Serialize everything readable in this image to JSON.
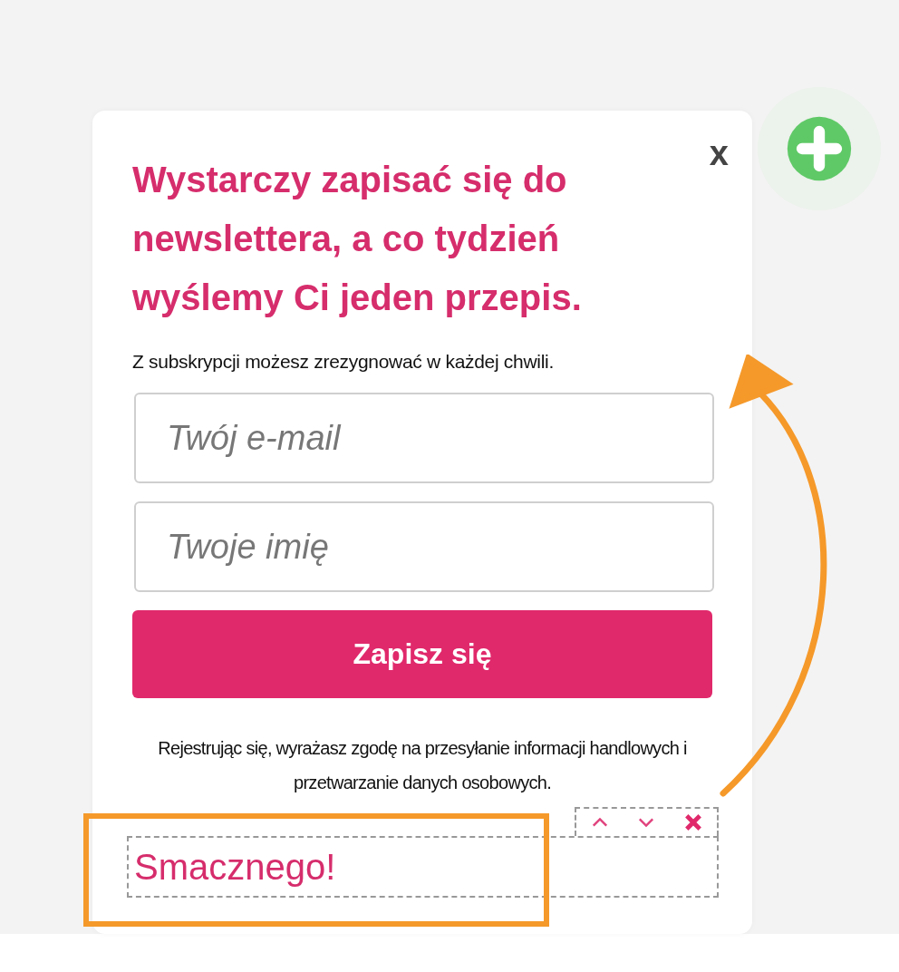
{
  "popup": {
    "close_label": "x",
    "heading": "Wystarczy zapisać się do newslettera, a co tydzień wyślemy Ci jeden przepis.",
    "subtitle": "Z subskrypcji możesz zrezygnować w każdej chwili.",
    "fields": [
      {
        "placeholder": "Twój e-mail"
      },
      {
        "placeholder": "Twoje imię"
      }
    ],
    "submit": "Zapisz się",
    "consent": "Rejestrując się, wyrażasz zgodę na przesyłanie informacji handlowych i przetwarzanie danych osobowych.",
    "editable_text": "Smacznego!",
    "highlighted": true
  }
}
